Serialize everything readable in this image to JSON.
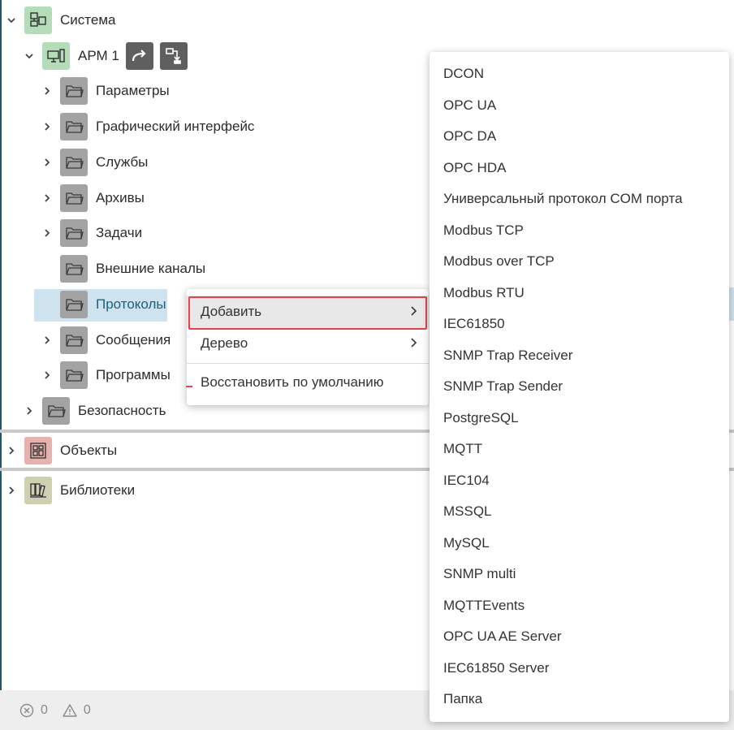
{
  "tree": {
    "system": {
      "label": "Система",
      "icon": "system-icon"
    },
    "arm": {
      "label": "АРМ 1",
      "icon": "workstation-icon",
      "actions": [
        "redirect-arrow-icon",
        "move-down-icon"
      ]
    },
    "folders": [
      {
        "label": "Параметры",
        "expandable": true
      },
      {
        "label": "Графический интерфейс",
        "expandable": true
      },
      {
        "label": "Службы",
        "expandable": true
      },
      {
        "label": "Архивы",
        "expandable": true
      },
      {
        "label": "Задачи",
        "expandable": true
      },
      {
        "label": "Внешние каналы",
        "expandable": false
      },
      {
        "label": "Протоколы",
        "expandable": false,
        "selected": true
      },
      {
        "label": "Сообщения",
        "expandable": true
      },
      {
        "label": "Программы",
        "expandable": true
      }
    ],
    "security": {
      "label": "Безопасность"
    },
    "objects": {
      "label": "Объекты",
      "icon": "objects-icon"
    },
    "libraries": {
      "label": "Библиотеки",
      "icon": "libraries-icon"
    }
  },
  "status": {
    "errors": "0",
    "warnings": "0"
  },
  "context_menu": {
    "add": "Добавить",
    "tree": "Дерево",
    "restore": "Восстановить по умолчанию"
  },
  "submenu": {
    "items": [
      "DCON",
      "OPC UA",
      "OPC DA",
      "OPC HDA",
      "Универсальный протокол COM порта",
      "Modbus TCP",
      "Modbus over TCP",
      "Modbus RTU",
      "IEC61850",
      "SNMP Trap Receiver",
      "SNMP Trap Sender",
      "PostgreSQL",
      "MQTT",
      "IEC104",
      "MSSQL",
      "MySQL",
      "SNMP multi",
      "MQTTEvents",
      "OPC UA AE Server",
      "IEC61850 Server",
      "Папка"
    ]
  },
  "colors": {
    "accent": "#1e5f80",
    "selection": "#cfe3ee",
    "highlight_border": "#e3424a"
  }
}
